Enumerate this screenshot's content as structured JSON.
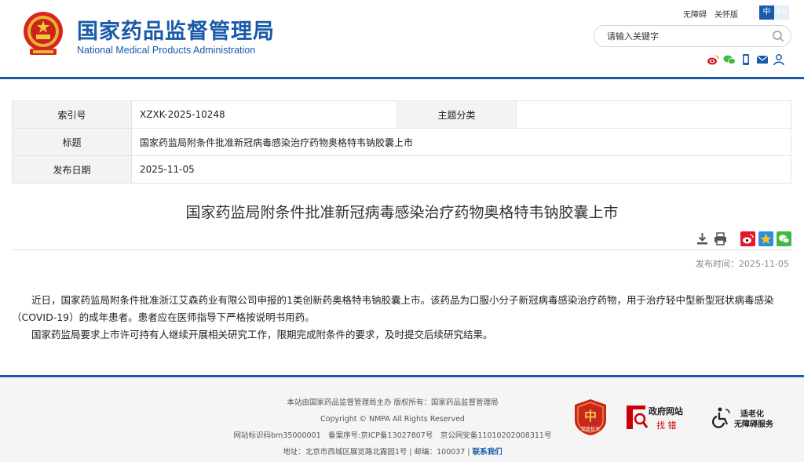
{
  "header": {
    "name_cn": "国家药品监督管理局",
    "name_en": "National Medical Products Administration",
    "accessibility_link": "无障碍",
    "elderly_link": "关怀版",
    "lang_zh": "中",
    "lang_en": "En",
    "search_placeholder": "请输入关键字",
    "social_icons": [
      "weibo-icon",
      "wechat-icon",
      "mobile-icon",
      "mail-icon",
      "user-icon"
    ],
    "accent_color": "#1a5aa8"
  },
  "meta": {
    "index_label": "索引号",
    "index_value": "XZXK-2025-10248",
    "category_label": "主题分类",
    "category_value": "",
    "title_label": "标题",
    "title_value": "国家药监局附条件批准新冠病毒感染治疗药物奥格特韦钠胶囊上市",
    "date_label": "发布日期",
    "date_value": "2025-11-05"
  },
  "article": {
    "title": "国家药监局附条件批准新冠病毒感染治疗药物奥格特韦钠胶囊上市",
    "pubtime": "发布时间：2025-11-05",
    "paragraphs": [
      "近日，国家药监局附条件批准浙江艾森药业有限公司申报的1类创新药奥格特韦钠胶囊上市。该药品为口服小分子新冠病毒感染治疗药物，用于治疗轻中型新型冠状病毒感染（COVID-19）的成年患者。患者应在医师指导下严格按说明书用药。",
      "国家药监局要求上市许可持有人继续开展相关研究工作，限期完成附条件的要求，及时提交后续研究结果。"
    ]
  },
  "footer": {
    "line1": "本站由国家药品监督管理局主办 版权所有：国家药品监督管理局",
    "line2": "Copyright © NMPA All Rights Reserved",
    "line3": "网站标识码bm35000001　备案序号:京ICP备13027807号　京公网安备11010202008311号",
    "line4": "地址：北京市西城区展览路北露园1号 | 邮编：100037 |",
    "contact": "联系我们",
    "badge1_text": "党政机关",
    "badge2_t1": "政府网站",
    "badge2_t2": "找 错",
    "badge3_t1": "适老化",
    "badge3_t2": "无障碍服务"
  }
}
